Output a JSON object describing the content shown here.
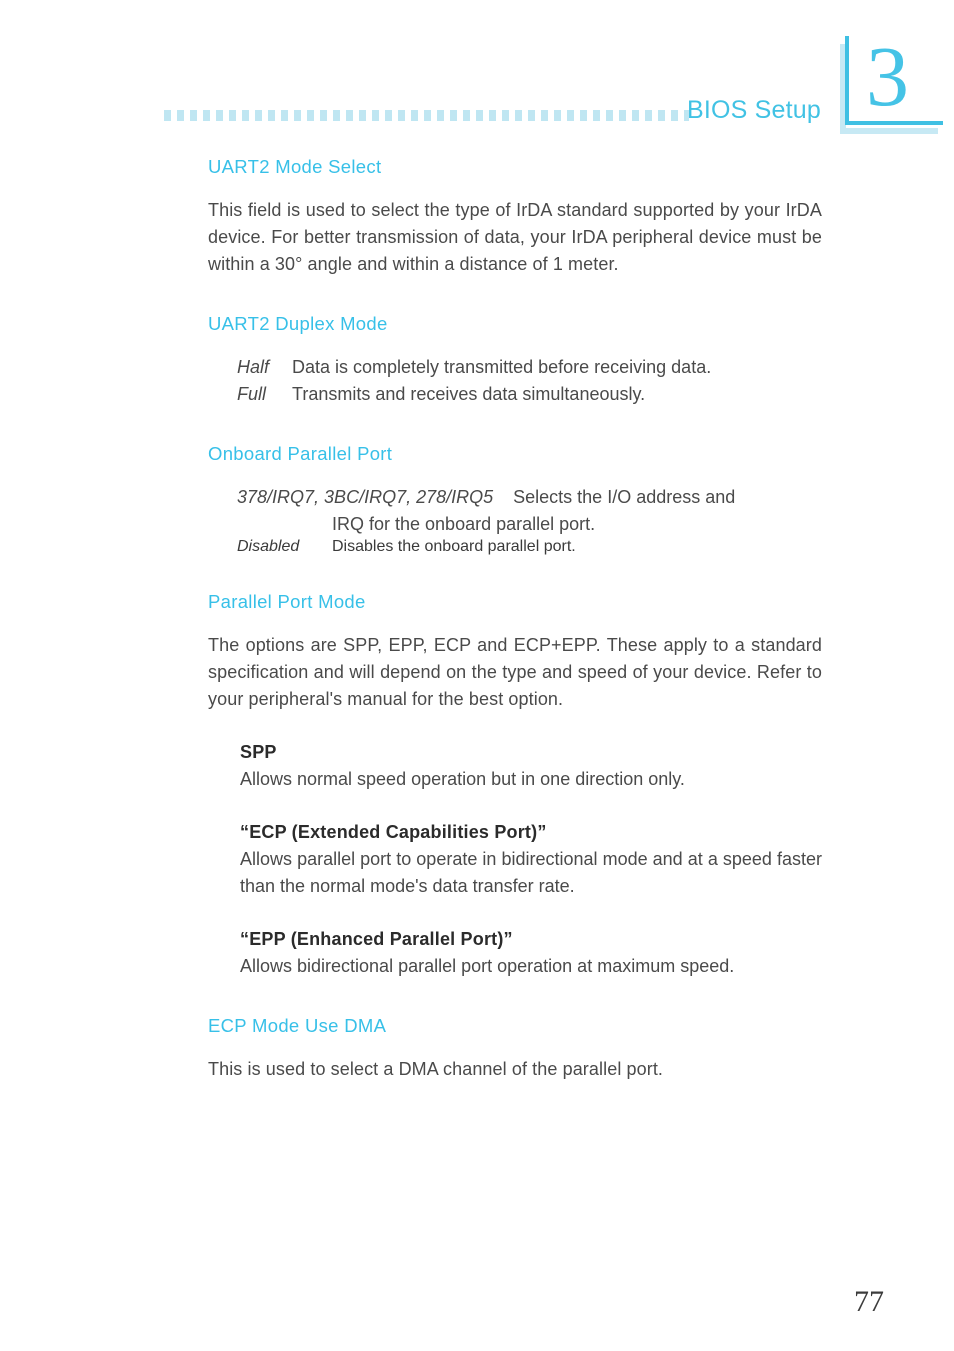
{
  "header": {
    "title": "BIOS Setup",
    "chapter_number": "3",
    "rule_color": "#bfe6f2",
    "title_color": "#41c2e4",
    "chapter_color": "#45c3e6"
  },
  "colors": {
    "heading": "#37c0e8",
    "body": "#4a4a4a",
    "accent_light": "#c7e9f4"
  },
  "sections": {
    "uart2_mode_select": {
      "heading": "UART2 Mode Select",
      "paragraph": "This field is used to select the type of IrDA standard supported by your IrDA device. For better transmission of data, your IrDA peripheral device must be within a 30° angle and within a distance of 1 meter."
    },
    "uart2_duplex_mode": {
      "heading": "UART2 Duplex Mode",
      "items": [
        {
          "term": "Half",
          "desc": "Data is completely transmitted before receiving data."
        },
        {
          "term": "Full",
          "desc": "Transmits and receives data simultaneously."
        }
      ]
    },
    "onboard_parallel_port": {
      "heading": "Onboard Parallel Port",
      "item_io": {
        "term": "378/IRQ7, 3BC/IRQ7, 278/IRQ5",
        "desc_line1": "Selects the I/O address and",
        "desc_line2": "IRQ for the onboard parallel port."
      },
      "item_disabled": {
        "term": "Disabled",
        "desc": "Disables the onboard parallel port."
      }
    },
    "parallel_port_mode": {
      "heading": "Parallel Port Mode",
      "paragraph": "The options are SPP, EPP, ECP and ECP+EPP. These apply to a standard specification and will depend on the type and speed of your device. Refer to your peripheral's manual for the best option.",
      "modes": [
        {
          "title": "SPP",
          "desc": "Allows normal speed operation but in one direction only."
        },
        {
          "title": "“ECP (Extended Capabilities Port)”",
          "desc": "Allows parallel port to operate in bidirectional mode and at a speed faster than the normal mode's data transfer rate."
        },
        {
          "title": "“EPP (Enhanced Parallel Port)”",
          "desc": "Allows bidirectional parallel port operation at maximum speed."
        }
      ]
    },
    "ecp_mode_use_dma": {
      "heading": "ECP Mode Use DMA",
      "paragraph": "This is used to select a DMA channel of the parallel port."
    }
  },
  "footer": {
    "page_number": "77"
  }
}
